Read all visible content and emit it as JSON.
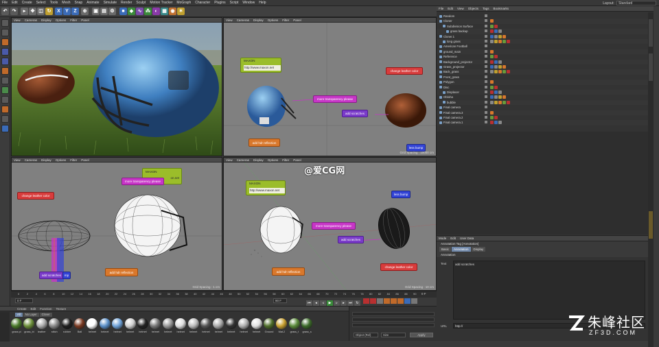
{
  "menubar": {
    "items": [
      "File",
      "Edit",
      "Create",
      "Select",
      "Tools",
      "Mesh",
      "Snap",
      "Animate",
      "Simulate",
      "Render",
      "Sculpt",
      "Motion Tracker",
      "MoGraph",
      "Character",
      "Plugins",
      "Script",
      "Window",
      "Help"
    ],
    "layout_label": "Layout:",
    "layout_value": "Standard"
  },
  "toolbar": {
    "axis_x": "X",
    "axis_y": "Y",
    "axis_z": "Z"
  },
  "viewports": {
    "menu": [
      "View",
      "Cameras",
      "Display",
      "Options",
      "Filter",
      "Panel"
    ],
    "top_right": {
      "label": "Perspective",
      "grid": "Grid Spacing : 10000 cm"
    },
    "bottom_left": {
      "label": "Right",
      "grid": "Grid Spacing : 1 cm"
    },
    "bottom_right": {
      "label": "Perspective",
      "grid": "Grid Spacing : 10 cm"
    }
  },
  "annotations": {
    "tr": {
      "maxon": "MAXON",
      "url": "http://www.maxon.net",
      "transparency": "more transparency please",
      "scratches": "add scratches",
      "leather": "change leather color",
      "hdr": "add hdr reflection",
      "bump": "less bump"
    },
    "bl": {
      "leather": "change leather color",
      "maxon": "MAXON",
      "transparency": "more transparency please",
      "url_partial": "on.net",
      "scratches": "add scratches",
      "bump_partial": "mp",
      "hdr": "add hdr reflection"
    },
    "br": {
      "maxon": "MAXON",
      "url": "http://www.maxon.net",
      "transparency": "more transparency please",
      "scratches": "add scratches",
      "bump": "less bump",
      "leather": "change leather color",
      "hdr": "add hdr reflection"
    }
  },
  "overlay_watermark": "@爱CG网",
  "object_manager": {
    "menu": [
      "File",
      "Edit",
      "View",
      "Objects",
      "Tags",
      "Bookmarks"
    ],
    "rows": [
      {
        "name": "Random",
        "indent": 0
      },
      {
        "name": "Cloner",
        "indent": 0
      },
      {
        "name": "Subdivision Surface",
        "indent": 1
      },
      {
        "name": "grass backup",
        "indent": 2
      },
      {
        "name": "Cloner.1",
        "indent": 0
      },
      {
        "name": "long grass",
        "indent": 1
      },
      {
        "name": "American Football",
        "indent": 0
      },
      {
        "name": "ground_main",
        "indent": 0
      },
      {
        "name": "Reference",
        "indent": 0
      },
      {
        "name": "Background_projector",
        "indent": 0
      },
      {
        "name": "Grass_projector",
        "indent": 0
      },
      {
        "name": "Back_grass",
        "indent": 0
      },
      {
        "name": "Front_grass",
        "indent": 0
      },
      {
        "name": "Polygon",
        "indent": 0
      },
      {
        "name": "Disc",
        "indent": 0
      },
      {
        "name": "Displacer",
        "indent": 1
      },
      {
        "name": "Obloha",
        "indent": 0
      },
      {
        "name": "bubble",
        "indent": 1
      },
      {
        "name": "Final camera",
        "indent": 0
      },
      {
        "name": "Final camera.3",
        "indent": 0
      },
      {
        "name": "Final camera.2",
        "indent": 0
      },
      {
        "name": "Final camera.1",
        "indent": 0
      }
    ]
  },
  "attribute_manager": {
    "menu": [
      "Mode",
      "Edit",
      "User Data"
    ],
    "title": "Annotation Tag [Annotation]",
    "tabs": [
      "Basic",
      "Annotation",
      "Display"
    ],
    "active_tab": "Annotation",
    "section": "Annotation",
    "text_label": "Text",
    "text_value": "add scratches",
    "url_label": "URL",
    "url_value": "http://"
  },
  "material_manager": {
    "menu": [
      "Create",
      "Edit",
      "Function",
      "Texture"
    ],
    "filters": [
      "All",
      "No Layer",
      "Clover"
    ],
    "materials": [
      {
        "name": "grass pl",
        "color": "#4a7a2a"
      },
      {
        "name": "grass_bl",
        "color": "#6c8f3a"
      },
      {
        "name": "leather",
        "color": "#aaaaaa"
      },
      {
        "name": "stitch",
        "color": "#888888"
      },
      {
        "name": "rubber",
        "color": "#1e1e1e"
      },
      {
        "name": "Ball",
        "color": "#7a3a22"
      },
      {
        "name": "helmet",
        "color": "#ffffff"
      },
      {
        "name": "helmet",
        "color": "#5a8fc8"
      },
      {
        "name": "helmet",
        "color": "#6fa2d8"
      },
      {
        "name": "helmet",
        "color": "#cfcfcf"
      },
      {
        "name": "helmet",
        "color": "#222222"
      },
      {
        "name": "helmet",
        "color": "#777777"
      },
      {
        "name": "helmet",
        "color": "#999999"
      },
      {
        "name": "helmet",
        "color": "#dddddd"
      },
      {
        "name": "helmet",
        "color": "#bbbbbb"
      },
      {
        "name": "helmet",
        "color": "#555555"
      },
      {
        "name": "helmet",
        "color": "#aaaaaa"
      },
      {
        "name": "helmet",
        "color": "#333333"
      },
      {
        "name": "helmet",
        "color": "#b0b0b0"
      },
      {
        "name": "helmet",
        "color": "#e0e0e0"
      },
      {
        "name": "Ground",
        "color": "#4f6e2a"
      },
      {
        "name": "Mat.2",
        "color": "#c8a030"
      },
      {
        "name": "grass_t",
        "color": "#5a8a3a"
      },
      {
        "name": "grass_s",
        "color": "#3c6a2a"
      }
    ]
  },
  "coords": {
    "dropdown1": "Object (Rel)",
    "dropdown2": "Size",
    "apply": "Apply"
  },
  "timeline": {
    "ticks": [
      "0",
      "2",
      "4",
      "6",
      "8",
      "10",
      "12",
      "14",
      "16",
      "18",
      "20",
      "22",
      "24",
      "26",
      "28",
      "30",
      "32",
      "34",
      "36",
      "38",
      "40",
      "42",
      "44",
      "46",
      "48",
      "50",
      "52",
      "54",
      "56",
      "58",
      "60",
      "62",
      "64",
      "66",
      "68",
      "70",
      "72",
      "74",
      "76",
      "78",
      "80",
      "82",
      "84",
      "86",
      "88",
      "90"
    ],
    "end_frame": "0 F",
    "start_field": "0 F",
    "end_field": "90 F"
  },
  "site_watermark": {
    "text": "朱峰社区",
    "sub": "ZF3D.COM"
  }
}
